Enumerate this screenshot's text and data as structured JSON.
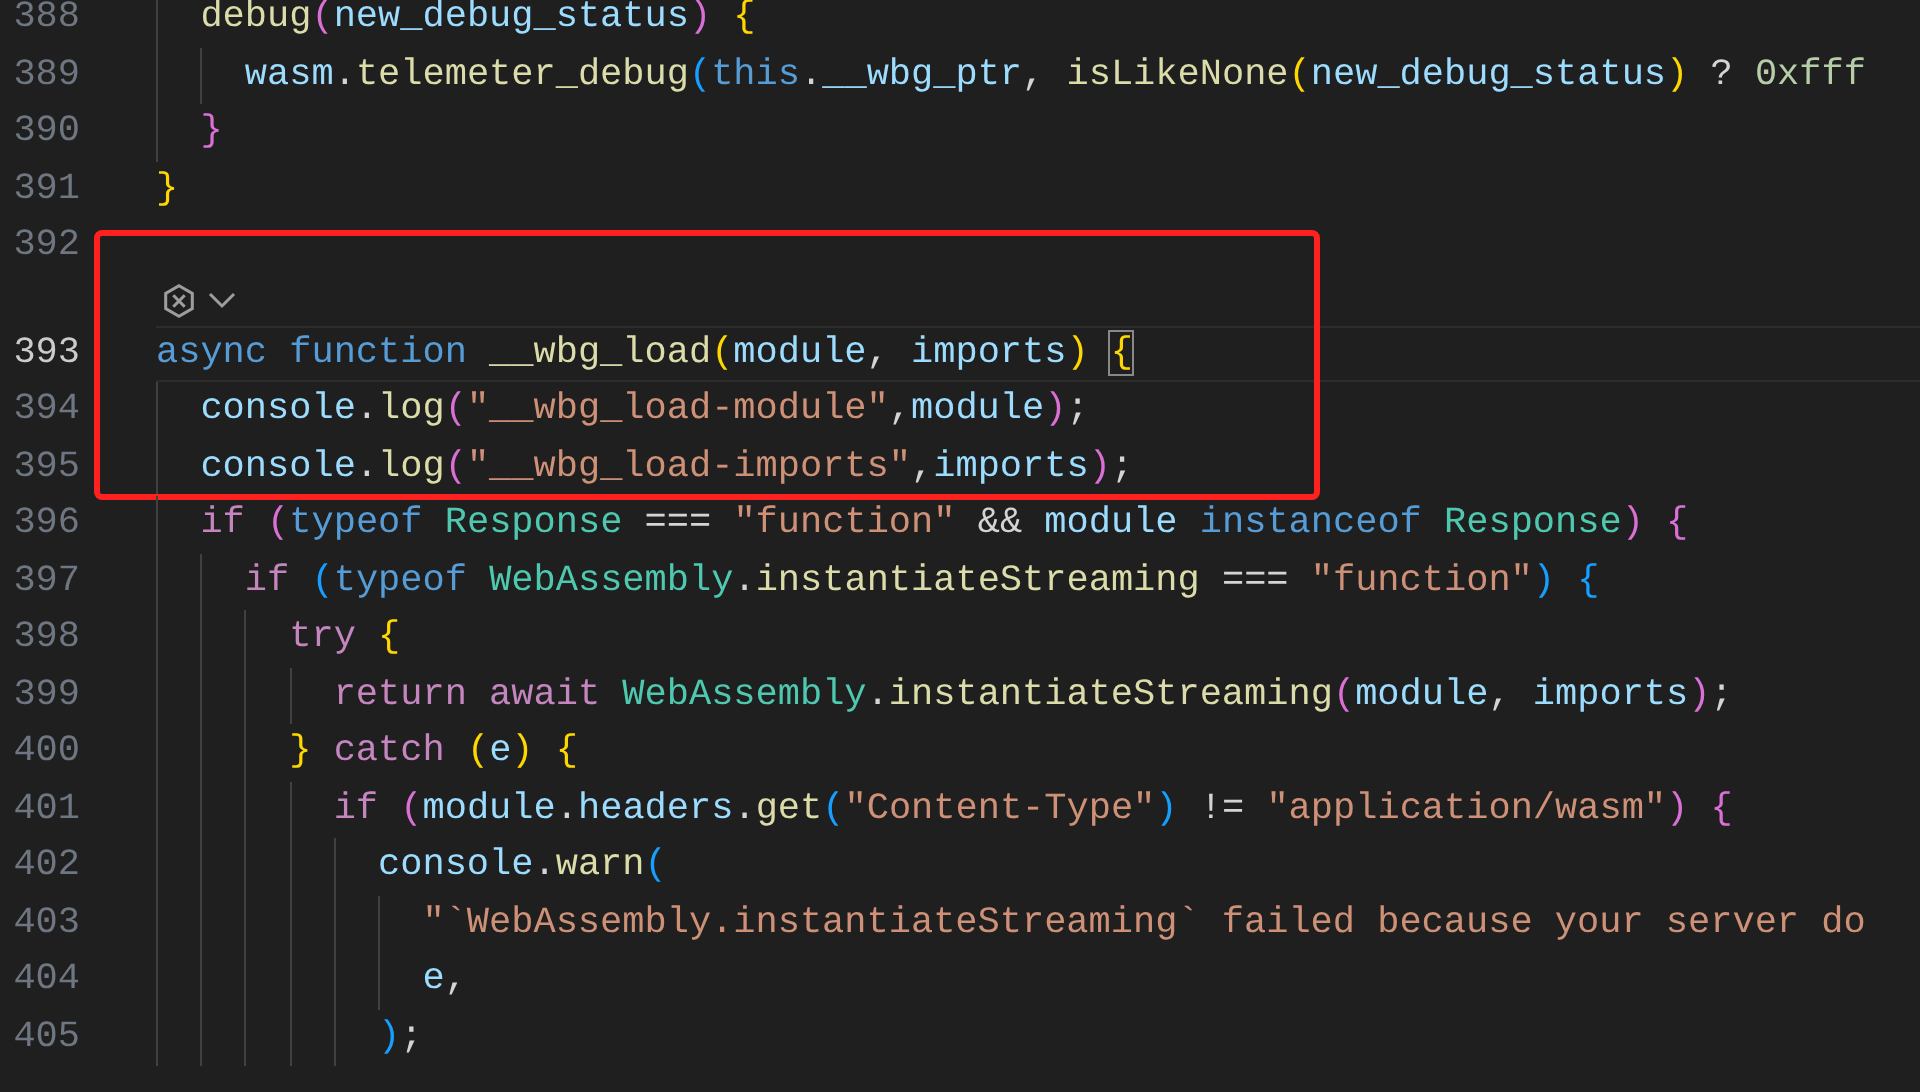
{
  "editor": {
    "sections": [
      {
        "lines": [
          {
            "number": "388",
            "tokens": [
              {
                "kind": "fn",
                "text": "  debug"
              },
              {
                "kind": "b2",
                "text": "("
              },
              {
                "kind": "var",
                "text": "new_debug_status"
              },
              {
                "kind": "b2",
                "text": ")"
              },
              {
                "kind": "b1",
                "text": " {"
              }
            ]
          },
          {
            "number": "389",
            "tokens": [
              {
                "kind": "var",
                "text": "    wasm"
              },
              {
                "kind": "op",
                "text": "."
              },
              {
                "kind": "fn",
                "text": "telemeter_debug"
              },
              {
                "kind": "b3",
                "text": "("
              },
              {
                "kind": "kw",
                "text": "this"
              },
              {
                "kind": "op",
                "text": "."
              },
              {
                "kind": "var",
                "text": "__wbg_ptr"
              },
              {
                "kind": "op",
                "text": ", "
              },
              {
                "kind": "fn",
                "text": "isLikeNone"
              },
              {
                "kind": "b1",
                "text": "("
              },
              {
                "kind": "var",
                "text": "new_debug_status"
              },
              {
                "kind": "b1",
                "text": ")"
              },
              {
                "kind": "op",
                "text": " ? "
              },
              {
                "kind": "num",
                "text": "0xfff"
              }
            ]
          },
          {
            "number": "390",
            "tokens": [
              {
                "kind": "b2",
                "text": "  }"
              }
            ]
          },
          {
            "number": "391",
            "tokens": [
              {
                "kind": "b1",
                "text": "}"
              }
            ]
          }
        ]
      },
      {
        "boxed": true,
        "lines": [
          {
            "number": "392"
          },
          {
            "number": "393",
            "active": true,
            "codelens": true,
            "tokens": [
              {
                "kind": "kw",
                "text": "async"
              },
              {
                "kind": "kw",
                "text": " function"
              },
              {
                "kind": "fn",
                "text": " __wbg_load"
              },
              {
                "kind": "b1",
                "text": "("
              },
              {
                "kind": "var",
                "text": "module"
              },
              {
                "kind": "op",
                "text": ", "
              },
              {
                "kind": "var",
                "text": "imports"
              },
              {
                "kind": "b1",
                "text": ")"
              },
              {
                "kind": "b1",
                "text": "{"
              }
            ]
          },
          {
            "number": "394",
            "tokens": [
              {
                "kind": "var",
                "text": "  console"
              },
              {
                "kind": "op",
                "text": "."
              },
              {
                "kind": "fn",
                "text": "log"
              },
              {
                "kind": "b2",
                "text": "("
              },
              {
                "kind": "str",
                "text": "\"__wbg_load-module\""
              },
              {
                "kind": "op",
                "text": ","
              },
              {
                "kind": "var",
                "text": "module"
              },
              {
                "kind": "b2",
                "text": ")"
              },
              {
                "kind": "op",
                "text": ";"
              }
            ]
          },
          {
            "number": "395",
            "tokens": [
              {
                "kind": "var",
                "text": "  console"
              },
              {
                "kind": "op",
                "text": "."
              },
              {
                "kind": "fn",
                "text": "log"
              },
              {
                "kind": "b2",
                "text": "("
              },
              {
                "kind": "str",
                "text": "\"__wbg_load-imports\""
              },
              {
                "kind": "op",
                "text": ","
              },
              {
                "kind": "var",
                "text": "imports"
              },
              {
                "kind": "b2",
                "text": ")"
              },
              {
                "kind": "op",
                "text": ";"
              }
            ]
          }
        ]
      },
      {
        "lines": [
          {
            "number": "396",
            "tokens": [
              {
                "kind": "ctl",
                "text": "  if"
              },
              {
                "kind": "b2",
                "text": " ("
              },
              {
                "kind": "kw",
                "text": "typeof"
              },
              {
                "kind": "cls",
                "text": " Response"
              },
              {
                "kind": "op",
                "text": " === "
              },
              {
                "kind": "str",
                "text": "\"function\""
              },
              {
                "kind": "op",
                "text": " && "
              },
              {
                "kind": "var",
                "text": "module"
              },
              {
                "kind": "kw",
                "text": " instanceof"
              },
              {
                "kind": "cls",
                "text": " Response"
              },
              {
                "kind": "b2",
                "text": ")"
              },
              {
                "kind": "b2",
                "text": " {"
              }
            ]
          },
          {
            "number": "397",
            "tokens": [
              {
                "kind": "ctl",
                "text": "    if"
              },
              {
                "kind": "b3",
                "text": " ("
              },
              {
                "kind": "kw",
                "text": "typeof"
              },
              {
                "kind": "cls",
                "text": " WebAssembly"
              },
              {
                "kind": "op",
                "text": "."
              },
              {
                "kind": "fn",
                "text": "instantiateStreaming"
              },
              {
                "kind": "op",
                "text": " === "
              },
              {
                "kind": "str",
                "text": "\"function\""
              },
              {
                "kind": "b3",
                "text": ")"
              },
              {
                "kind": "b3",
                "text": " {"
              }
            ]
          },
          {
            "number": "398",
            "tokens": [
              {
                "kind": "ctl",
                "text": "      try"
              },
              {
                "kind": "b1",
                "text": " {"
              }
            ]
          },
          {
            "number": "399",
            "tokens": [
              {
                "kind": "ctl",
                "text": "        return"
              },
              {
                "kind": "ctl",
                "text": " await"
              },
              {
                "kind": "cls",
                "text": " WebAssembly"
              },
              {
                "kind": "op",
                "text": "."
              },
              {
                "kind": "fn",
                "text": "instantiateStreaming"
              },
              {
                "kind": "b2",
                "text": "("
              },
              {
                "kind": "var",
                "text": "module"
              },
              {
                "kind": "op",
                "text": ", "
              },
              {
                "kind": "var",
                "text": "imports"
              },
              {
                "kind": "b2",
                "text": ")"
              },
              {
                "kind": "op",
                "text": ";"
              }
            ]
          },
          {
            "number": "400",
            "tokens": [
              {
                "kind": "b1",
                "text": "      }"
              },
              {
                "kind": "ctl",
                "text": " catch"
              },
              {
                "kind": "b1",
                "text": " ("
              },
              {
                "kind": "var",
                "text": "e"
              },
              {
                "kind": "b1",
                "text": ")"
              },
              {
                "kind": "b1",
                "text": " {"
              }
            ]
          },
          {
            "number": "401",
            "tokens": [
              {
                "kind": "ctl",
                "text": "        if"
              },
              {
                "kind": "b2",
                "text": " ("
              },
              {
                "kind": "var",
                "text": "module"
              },
              {
                "kind": "op",
                "text": "."
              },
              {
                "kind": "var",
                "text": "headers"
              },
              {
                "kind": "op",
                "text": "."
              },
              {
                "kind": "fn",
                "text": "get"
              },
              {
                "kind": "b3",
                "text": "("
              },
              {
                "kind": "str",
                "text": "\"Content-Type\""
              },
              {
                "kind": "b3",
                "text": ")"
              },
              {
                "kind": "op",
                "text": " != "
              },
              {
                "kind": "str",
                "text": "\"application/wasm\""
              },
              {
                "kind": "b2",
                "text": ")"
              },
              {
                "kind": "b2",
                "text": " {"
              }
            ]
          },
          {
            "number": "402",
            "tokens": [
              {
                "kind": "var",
                "text": "          console"
              },
              {
                "kind": "op",
                "text": "."
              },
              {
                "kind": "fn",
                "text": "warn"
              },
              {
                "kind": "b3",
                "text": "("
              }
            ]
          },
          {
            "number": "403",
            "tokens": [
              {
                "kind": "str",
                "text": "            \"`WebAssembly.instantiateStreaming` failed because your server do"
              }
            ]
          },
          {
            "number": "404",
            "tokens": [
              {
                "kind": "var",
                "text": "            e"
              },
              {
                "kind": "op",
                "text": ","
              }
            ]
          },
          {
            "number": "405",
            "tokens": [
              {
                "kind": "b3",
                "text": "          )"
              },
              {
                "kind": "op",
                "text": ";"
              }
            ]
          }
        ]
      }
    ]
  }
}
